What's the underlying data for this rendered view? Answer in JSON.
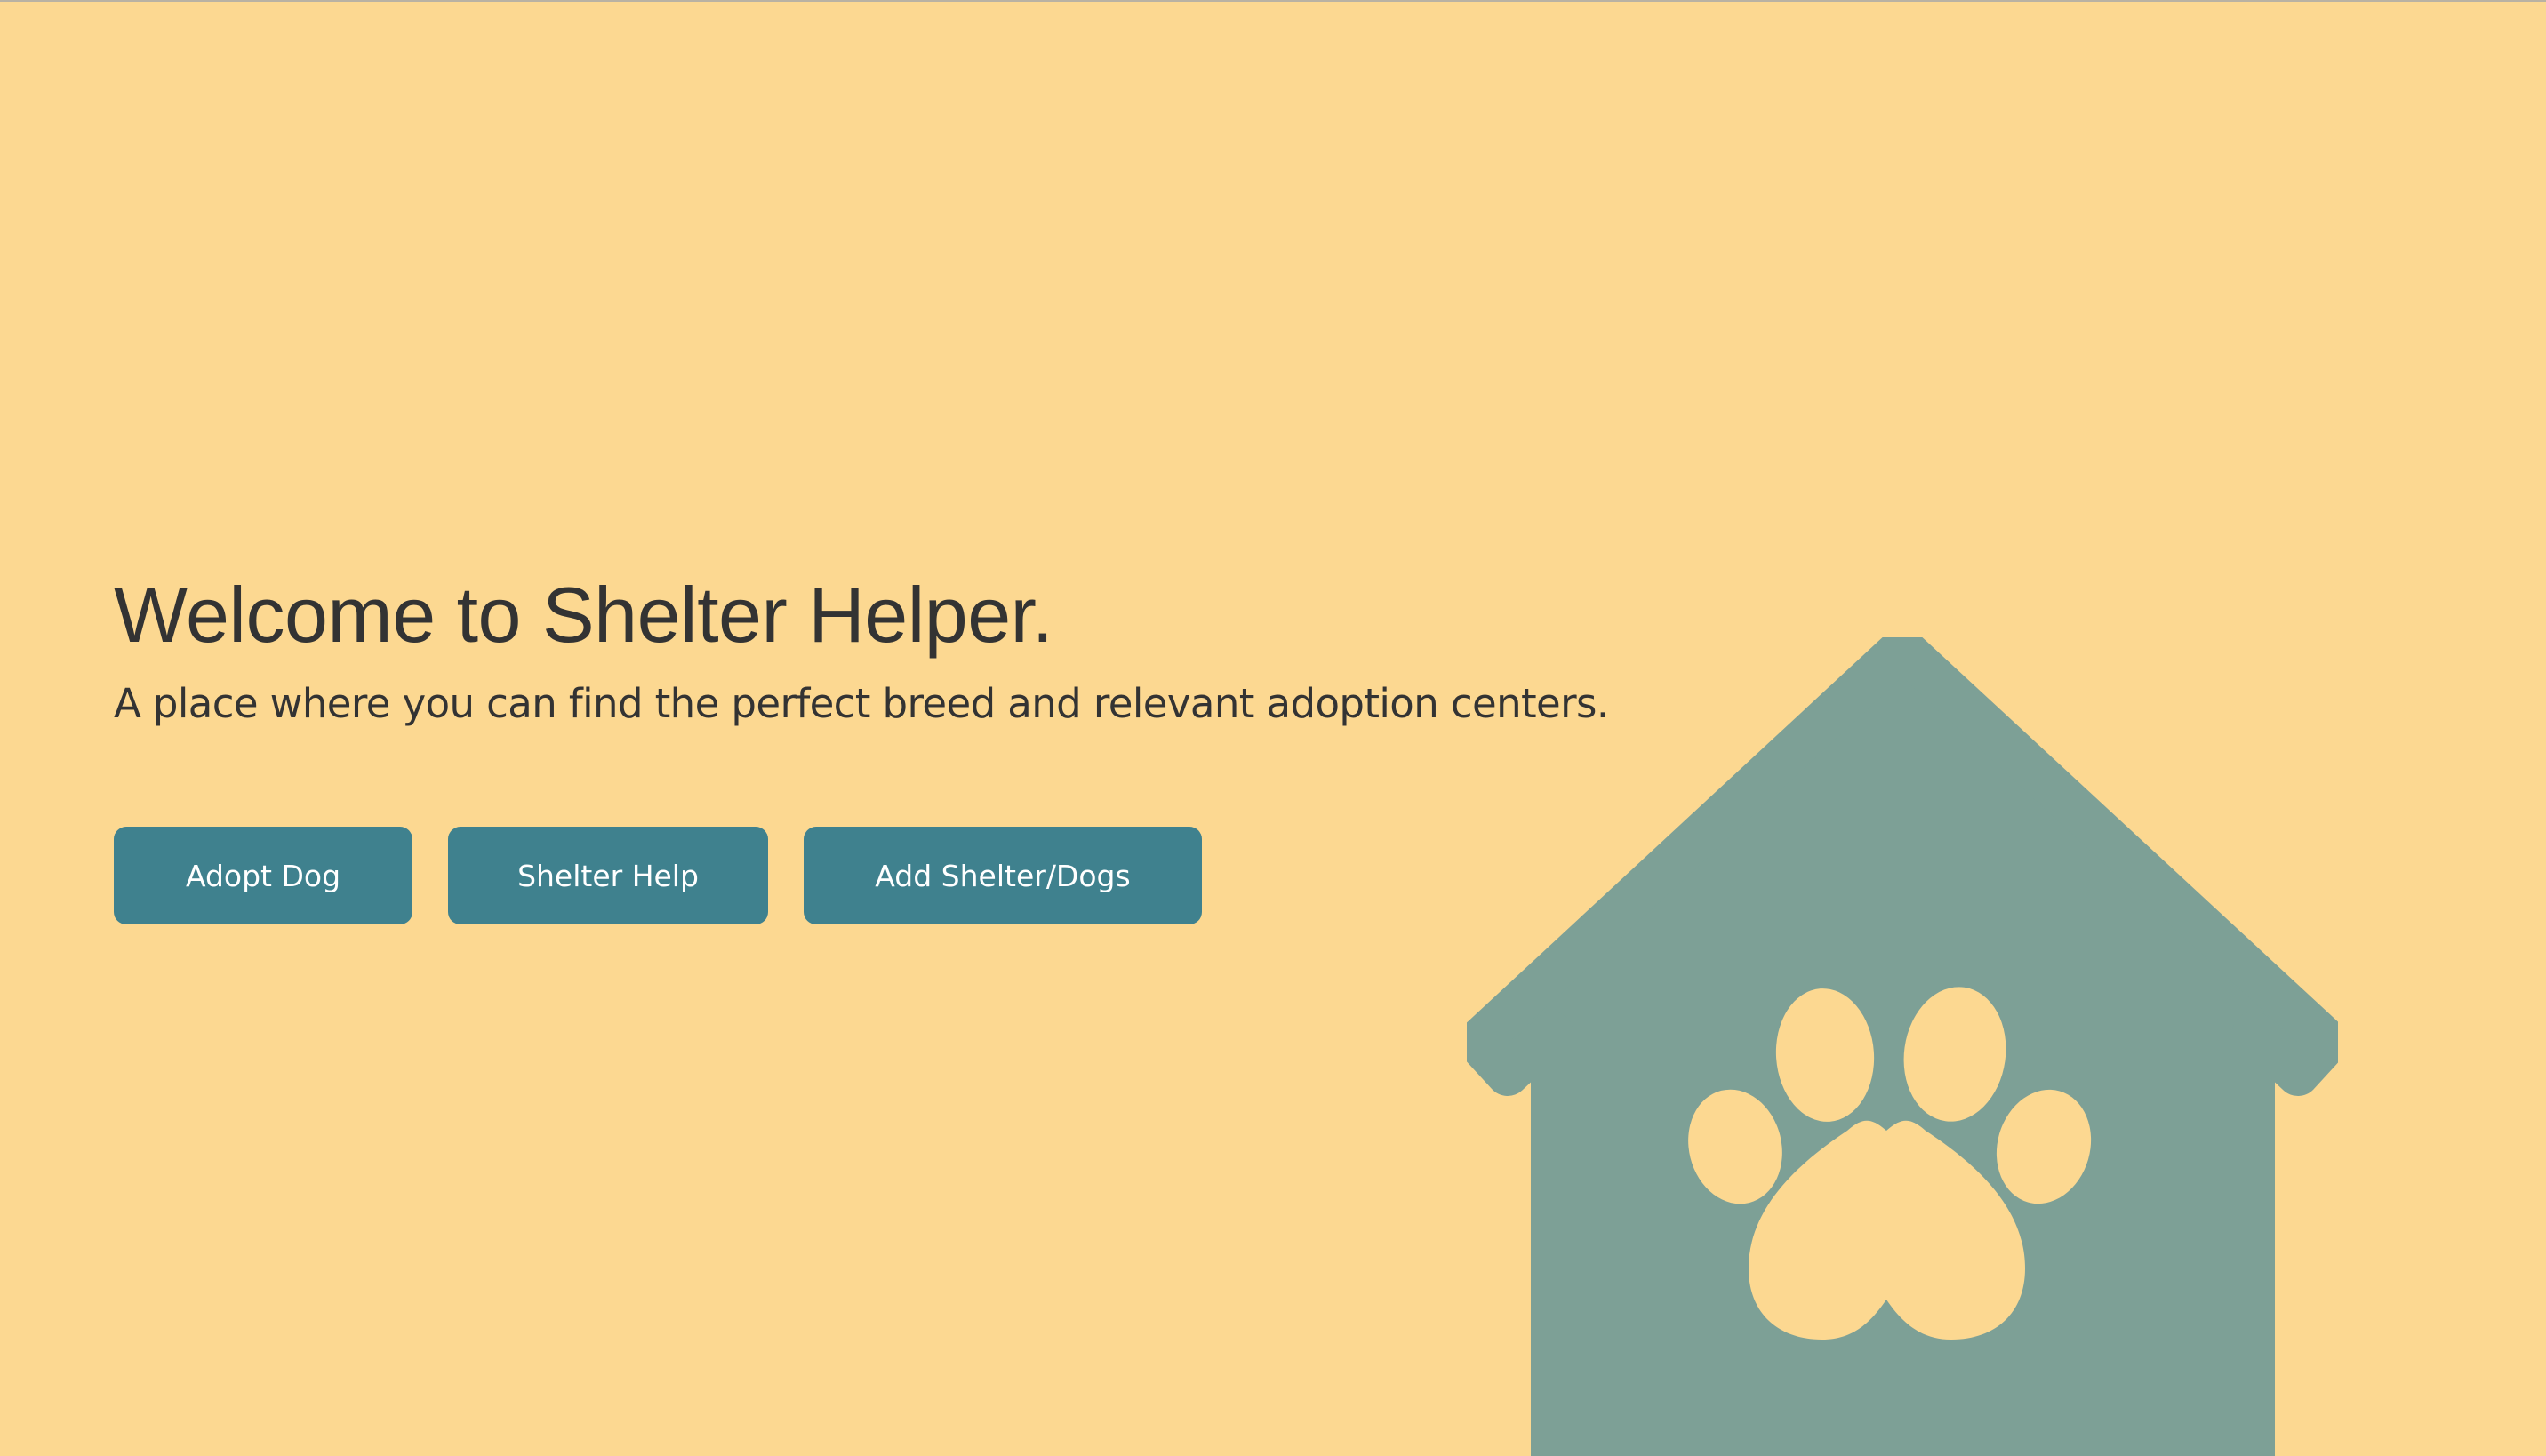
{
  "hero": {
    "title": "Welcome to Shelter Helper.",
    "subtitle": "A place where you can find the perfect breed and relevant adoption centers."
  },
  "actions": {
    "adopt_label": "Adopt Dog",
    "help_label": "Shelter Help",
    "add_label": "Add Shelter/Dogs"
  },
  "illustration": {
    "icon": "dog-house-paw-icon"
  },
  "colors": {
    "background": "#FCD891",
    "button": "#3F818E",
    "button_text": "#FFFFFF",
    "text": "#333333",
    "house": "#7DA096"
  }
}
